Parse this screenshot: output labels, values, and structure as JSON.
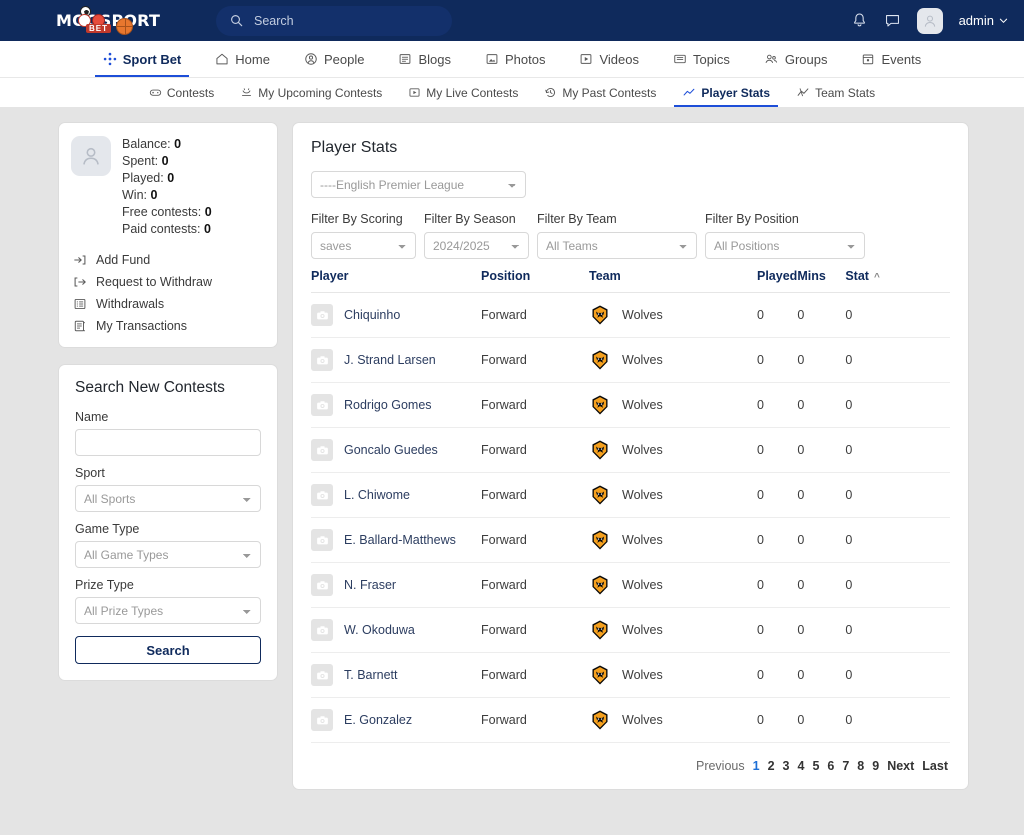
{
  "brand": {
    "name": "MOOSPORT",
    "tag": "BET",
    "primary": "#0f2a5c",
    "accent": "#1d4ed8",
    "team_color": "#f5a01e"
  },
  "header": {
    "search_placeholder": "Search",
    "search_value": "",
    "notifications_icon": "bell-icon",
    "messages_icon": "message-icon",
    "user_name": "admin",
    "user_chevron": "chevron-down-icon"
  },
  "mainnav": [
    {
      "label": "Sport Bet",
      "icon": "sportbet-icon",
      "active": true
    },
    {
      "label": "Home",
      "icon": "home-icon",
      "active": false
    },
    {
      "label": "People",
      "icon": "people-icon",
      "active": false
    },
    {
      "label": "Blogs",
      "icon": "blogs-icon",
      "active": false
    },
    {
      "label": "Photos",
      "icon": "photos-icon",
      "active": false
    },
    {
      "label": "Videos",
      "icon": "videos-icon",
      "active": false
    },
    {
      "label": "Topics",
      "icon": "topics-icon",
      "active": false
    },
    {
      "label": "Groups",
      "icon": "groups-icon",
      "active": false
    },
    {
      "label": "Events",
      "icon": "events-icon",
      "active": false
    }
  ],
  "subnav": [
    {
      "label": "Contests",
      "icon": "gamepad-icon",
      "active": false
    },
    {
      "label": "My Upcoming Contests",
      "icon": "upcoming-icon",
      "active": false
    },
    {
      "label": "My Live Contests",
      "icon": "live-icon",
      "active": false
    },
    {
      "label": "My Past Contests",
      "icon": "history-icon",
      "active": false
    },
    {
      "label": "Player Stats",
      "icon": "chart-line-icon",
      "active": true
    },
    {
      "label": "Team Stats",
      "icon": "chart-zigzag-icon",
      "active": false
    }
  ],
  "sidebar": {
    "balance": {
      "avatar_icon": "user-avatar-icon",
      "stats": [
        {
          "label": "Balance:",
          "value": "0"
        },
        {
          "label": "Spent:",
          "value": "0"
        },
        {
          "label": "Played:",
          "value": "0"
        },
        {
          "label": "Win:",
          "value": "0"
        },
        {
          "label": "Free contests:",
          "value": "0"
        },
        {
          "label": "Paid contests:",
          "value": "0"
        }
      ],
      "links": [
        {
          "label": "Add Fund",
          "icon": "sign-in-icon"
        },
        {
          "label": "Request to Withdraw",
          "icon": "sign-out-icon"
        },
        {
          "label": "Withdrawals",
          "icon": "list-icon"
        },
        {
          "label": "My Transactions",
          "icon": "book-icon"
        }
      ]
    },
    "search_contests": {
      "title": "Search New Contests",
      "name_label": "Name",
      "name_value": "",
      "name_placeholder": "",
      "sport_label": "Sport",
      "sport_value": "All Sports",
      "game_type_label": "Game Type",
      "game_type_value": "All Game Types",
      "prize_type_label": "Prize Type",
      "prize_type_value": "All Prize Types",
      "search_button": "Search"
    }
  },
  "main": {
    "title": "Player Stats",
    "league_value": "----English Premier League",
    "filters": [
      {
        "label": "Filter By Scoring",
        "value": "saves"
      },
      {
        "label": "Filter By Season",
        "value": "2024/2025"
      },
      {
        "label": "Filter By Team",
        "value": "All Teams"
      },
      {
        "label": "Filter By Position",
        "value": "All Positions"
      }
    ],
    "table": {
      "columns": [
        "Player",
        "Position",
        "Team",
        "Played",
        "Mins",
        "Stat"
      ],
      "sorted_column": "Stat",
      "sort_direction": "asc",
      "sort_caret": "caret-up-icon",
      "rows": [
        {
          "player": "Chiquinho",
          "position": "Forward",
          "team": "Wolves",
          "played": "0",
          "mins": "0",
          "stat": "0"
        },
        {
          "player": "J. Strand Larsen",
          "position": "Forward",
          "team": "Wolves",
          "played": "0",
          "mins": "0",
          "stat": "0"
        },
        {
          "player": "Rodrigo Gomes",
          "position": "Forward",
          "team": "Wolves",
          "played": "0",
          "mins": "0",
          "stat": "0"
        },
        {
          "player": "Goncalo Guedes",
          "position": "Forward",
          "team": "Wolves",
          "played": "0",
          "mins": "0",
          "stat": "0"
        },
        {
          "player": "L. Chiwome",
          "position": "Forward",
          "team": "Wolves",
          "played": "0",
          "mins": "0",
          "stat": "0"
        },
        {
          "player": "E. Ballard-Matthews",
          "position": "Forward",
          "team": "Wolves",
          "played": "0",
          "mins": "0",
          "stat": "0"
        },
        {
          "player": "N. Fraser",
          "position": "Forward",
          "team": "Wolves",
          "played": "0",
          "mins": "0",
          "stat": "0"
        },
        {
          "player": "W. Okoduwa",
          "position": "Forward",
          "team": "Wolves",
          "played": "0",
          "mins": "0",
          "stat": "0"
        },
        {
          "player": "T. Barnett",
          "position": "Forward",
          "team": "Wolves",
          "played": "0",
          "mins": "0",
          "stat": "0"
        },
        {
          "player": "E. Gonzalez",
          "position": "Forward",
          "team": "Wolves",
          "played": "0",
          "mins": "0",
          "stat": "0"
        }
      ]
    },
    "pagination": {
      "previous": "Previous",
      "pages": [
        "1",
        "2",
        "3",
        "4",
        "5",
        "6",
        "7",
        "8",
        "9"
      ],
      "current": "1",
      "next": "Next",
      "last": "Last"
    }
  }
}
